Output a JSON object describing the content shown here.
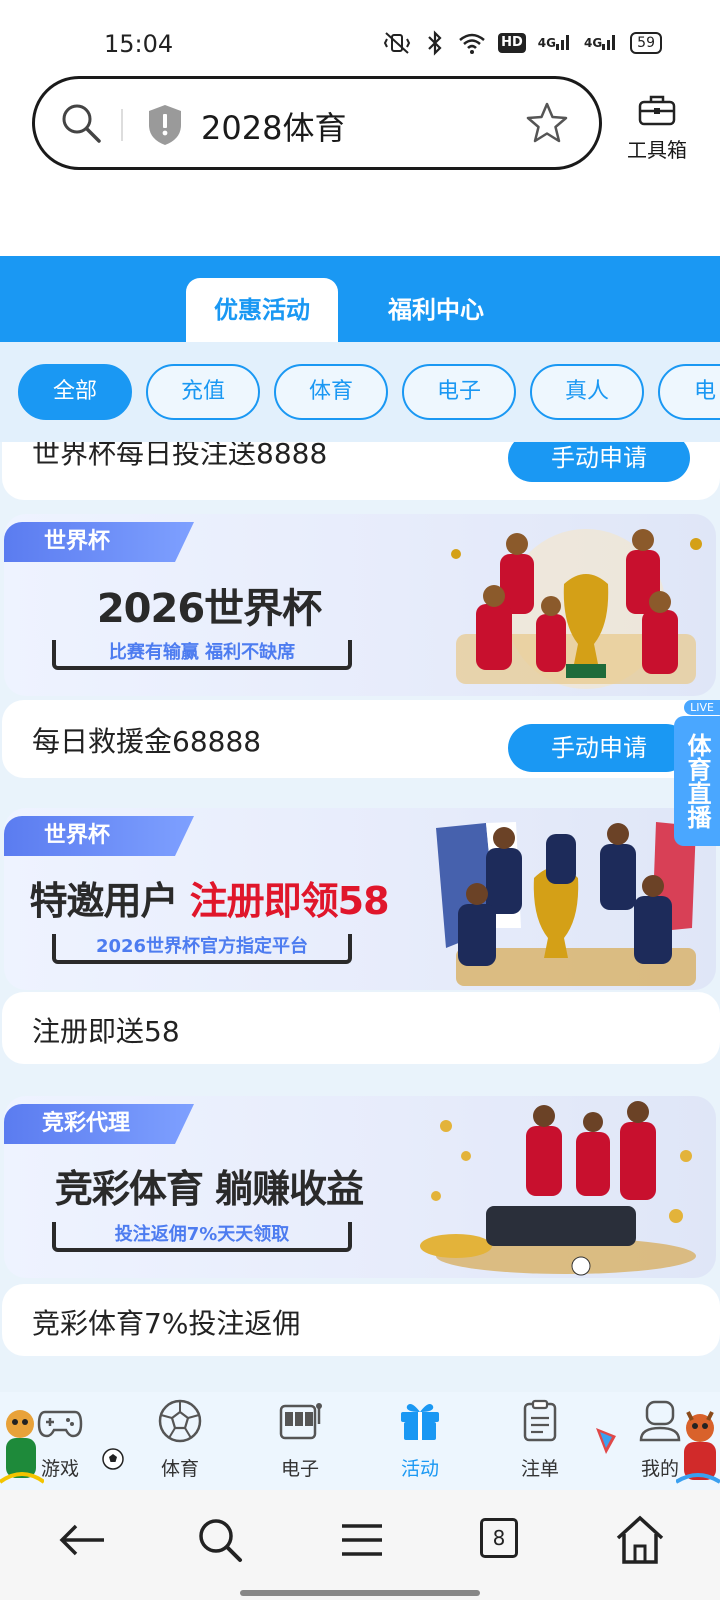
{
  "status_bar": {
    "time": "15:04",
    "net1": "4G",
    "net2": "4G",
    "hd": "HD",
    "battery": "59"
  },
  "browser": {
    "search_text": "2028体育",
    "toolbox_label": "工具箱"
  },
  "tabs": [
    {
      "label": "优惠活动",
      "active": true
    },
    {
      "label": "福利中心",
      "active": false
    }
  ],
  "filters": [
    {
      "label": "全部",
      "active": true
    },
    {
      "label": "充值"
    },
    {
      "label": "体育"
    },
    {
      "label": "电子"
    },
    {
      "label": "真人"
    },
    {
      "label": "电"
    }
  ],
  "promos": [
    {
      "title": "世界杯每日投注送8888",
      "button": "手动申请"
    },
    {
      "title": "每日救援金68888",
      "button": "手动申请"
    },
    {
      "title": "注册即送58"
    },
    {
      "title": "竞彩体育7%投注返佣"
    }
  ],
  "banners": [
    {
      "tag": "世界杯",
      "headline": "2026世界杯",
      "sub": "比赛有输赢 福利不缺席"
    },
    {
      "tag": "世界杯",
      "headline_dark": "特邀用户 ",
      "headline_red": "注册即领58",
      "sub": "2026世界杯官方指定平台"
    },
    {
      "tag": "竞彩代理",
      "headline": "竞彩体育 躺赚收益",
      "sub": "投注返佣7%天天领取"
    }
  ],
  "live_badge": {
    "top": "LIVE",
    "label": "体育直播"
  },
  "bottom_nav": [
    {
      "label": "游戏",
      "icon": "gamepad-icon"
    },
    {
      "label": "体育",
      "icon": "soccer-ball-icon"
    },
    {
      "label": "电子",
      "icon": "slot-machine-icon"
    },
    {
      "label": "活动",
      "icon": "gift-icon",
      "active": true
    },
    {
      "label": "注单",
      "icon": "clipboard-icon"
    },
    {
      "label": "我的",
      "icon": "profile-icon"
    }
  ],
  "system_nav": {
    "tab_count": "8"
  },
  "colors": {
    "accent": "#1a98f3",
    "red": "#e0162b"
  }
}
